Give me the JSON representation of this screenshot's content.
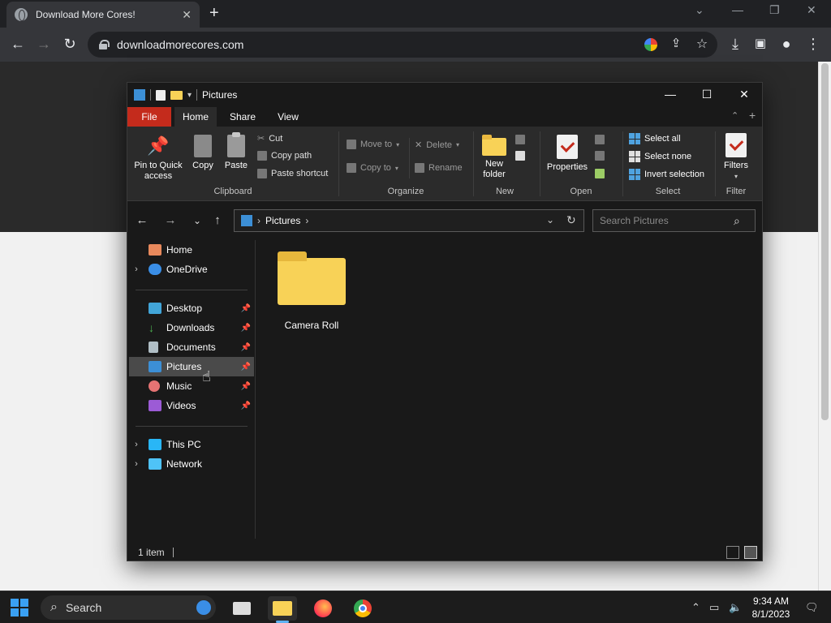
{
  "browser": {
    "tab_title": "Download More Cores!",
    "url": "downloadmorecores.com"
  },
  "explorer": {
    "title": "Pictures",
    "ribbon_tabs": [
      "File",
      "Home",
      "Share",
      "View"
    ],
    "clipboard": {
      "pin": "Pin to Quick access",
      "copy": "Copy",
      "paste": "Paste",
      "cut": "Cut",
      "copy_path": "Copy path",
      "paste_shortcut": "Paste shortcut",
      "label": "Clipboard"
    },
    "organize": {
      "move_to": "Move to",
      "copy_to": "Copy to",
      "delete": "Delete",
      "rename": "Rename",
      "label": "Organize"
    },
    "new": {
      "new_folder": "New folder",
      "label": "New"
    },
    "open": {
      "properties": "Properties",
      "label": "Open"
    },
    "select": {
      "select_all": "Select all",
      "select_none": "Select none",
      "invert": "Invert selection",
      "label": "Select"
    },
    "filter": {
      "filters": "Filters",
      "label": "Filter"
    },
    "address": {
      "segment": "Pictures"
    },
    "search_placeholder": "Search Pictures",
    "nav": {
      "home": "Home",
      "onedrive": "OneDrive",
      "desktop": "Desktop",
      "downloads": "Downloads",
      "documents": "Documents",
      "pictures": "Pictures",
      "music": "Music",
      "videos": "Videos",
      "thispc": "This PC",
      "network": "Network"
    },
    "items": [
      {
        "name": "Camera Roll"
      }
    ],
    "status": "1 item"
  },
  "taskbar": {
    "search": "Search",
    "time": "9:34 AM",
    "date": "8/1/2023"
  }
}
